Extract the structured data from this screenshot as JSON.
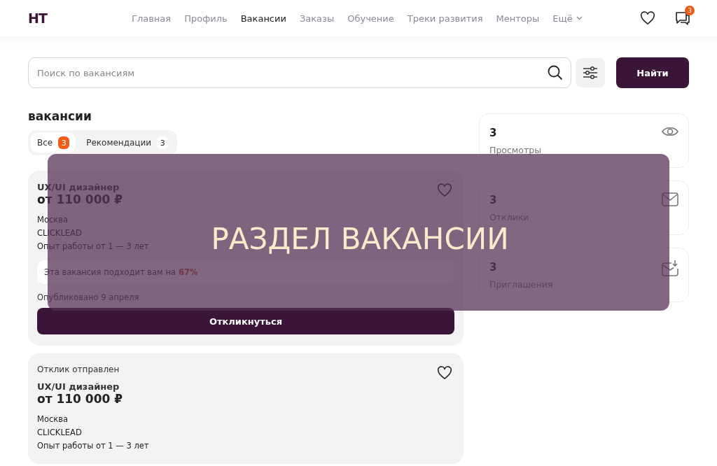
{
  "header": {
    "logo": "HT",
    "nav": [
      {
        "label": "Главная",
        "selected": false
      },
      {
        "label": "Профиль",
        "selected": false
      },
      {
        "label": "Вакансии",
        "selected": true
      },
      {
        "label": "Заказы",
        "selected": false
      },
      {
        "label": "Обучение",
        "selected": false
      },
      {
        "label": "Треки развития",
        "selected": false
      },
      {
        "label": "Менторы",
        "selected": false
      },
      {
        "label": "Ещё",
        "selected": false,
        "dropdown": true
      }
    ],
    "messages_badge": "3"
  },
  "search": {
    "placeholder": "Поиск по вакансиям",
    "button": "Найти"
  },
  "section_title": "вакансии",
  "tabs": [
    {
      "label": "Все",
      "count": "3",
      "selected": true
    },
    {
      "label": "Рекомендации",
      "count": "3",
      "selected": false
    }
  ],
  "vacancies": [
    {
      "title": "UX/UI дизайнер",
      "salary": "от 110 000 ₽",
      "city": "Москва",
      "company": "CLICKLEAD",
      "experience": "Опыт работы от 1 — 3 лет",
      "match_text": "Эта вакансия подходит вам на",
      "match_value": "67%",
      "published": "Опубликовано 9 апреля",
      "action": "Откликнуться"
    },
    {
      "status": "Отклик отправлен",
      "title": "UX/UI дизайнер",
      "salary": "от 110 000 ₽",
      "city": "Москва",
      "company": "CLICKLEAD",
      "experience": "Опыт работы от 1 — 3 лет"
    }
  ],
  "stats": [
    {
      "kind": "views",
      "value": "3",
      "label": "Просмотры"
    },
    {
      "kind": "responses",
      "value": "3",
      "label": "Отклики"
    },
    {
      "kind": "invitations",
      "value": "3",
      "label": "Приглашения"
    }
  ],
  "overlay": {
    "caption": "РАЗДЕЛ ВАКАНСИИ"
  }
}
